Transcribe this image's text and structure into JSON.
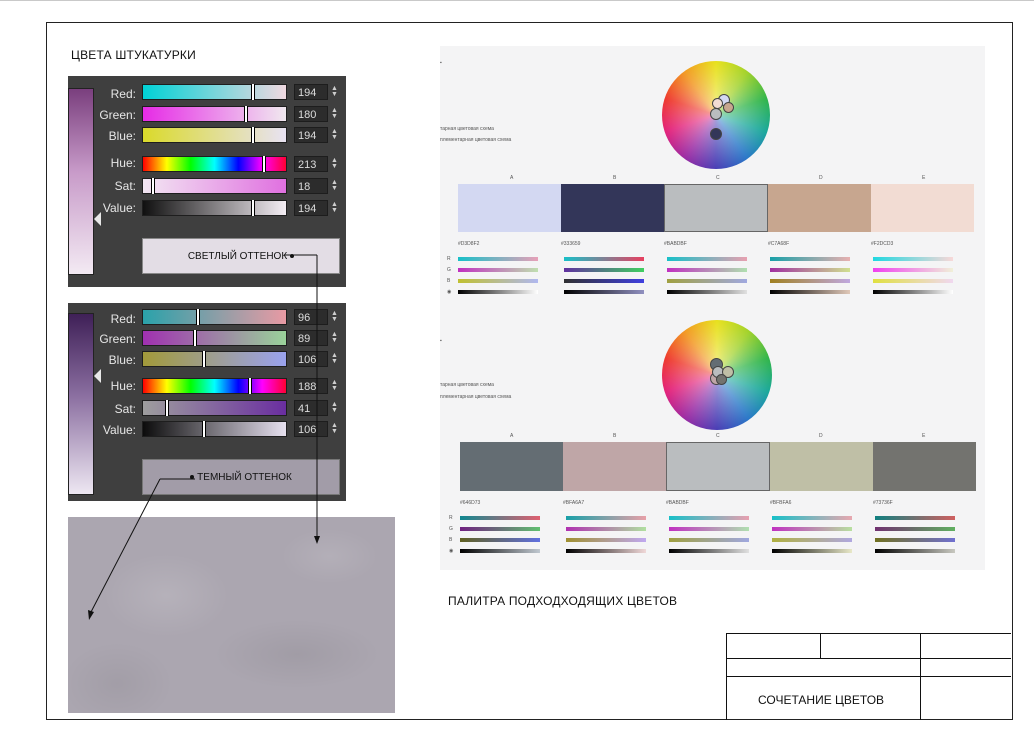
{
  "headings": {
    "plaster_colors": "ЦВЕТА ШТУКАТУРКИ",
    "palette": "ПАЛИТРА ПОДХОДХОДЯЩИХ ЦВЕТОВ"
  },
  "light_picker": {
    "labels": [
      "Red:",
      "Green:",
      "Blue:",
      "Hue:",
      "Sat:",
      "Value:"
    ],
    "values": [
      "194",
      "180",
      "194",
      "213",
      "18",
      "194"
    ],
    "button_label": "СВЕТЛЫЙ ОТТЕНОК",
    "swatch_color": "#c2b4c2"
  },
  "dark_picker": {
    "labels": [
      "Red:",
      "Green:",
      "Blue:",
      "Hue:",
      "Sat:",
      "Value:"
    ],
    "values": [
      "96",
      "89",
      "106",
      "188",
      "41",
      "106"
    ],
    "button_label": "ТЕМНЫЙ ОТТЕНОК",
    "swatch_color": "#60596a"
  },
  "palette_top": {
    "scheme_labels": [
      "тарная цветовая схема",
      "плементарная цветовая схема"
    ],
    "column_letters": [
      "A",
      "B",
      "C",
      "D",
      "E"
    ],
    "colors": [
      "#D3D8F2",
      "#333659",
      "#BABDBF",
      "#C7A68F",
      "#F2DCD3"
    ],
    "hex_labels": [
      "#D3D8F2",
      "#333659",
      "#BABDBF",
      "#C7A68F",
      "#F2DCD3"
    ],
    "rgb_letters": [
      "R",
      "G",
      "B",
      "◉"
    ]
  },
  "palette_bottom": {
    "scheme_labels": [
      "тарная цветовая схема",
      "плементарная цветовая схема"
    ],
    "column_letters": [
      "A",
      "B",
      "C",
      "D",
      "E"
    ],
    "colors": [
      "#646D73",
      "#BFA6A7",
      "#BABDBF",
      "#BFBFA6",
      "#73736F"
    ],
    "hex_labels": [
      "#646D73",
      "#BFA6A7",
      "#BABDBF",
      "#BFBFA6",
      "#73736F"
    ],
    "rgb_letters": [
      "R",
      "G",
      "B",
      "◉"
    ]
  },
  "title_block": {
    "title": "СОЧЕТАНИЕ ЦВЕТОВ"
  }
}
